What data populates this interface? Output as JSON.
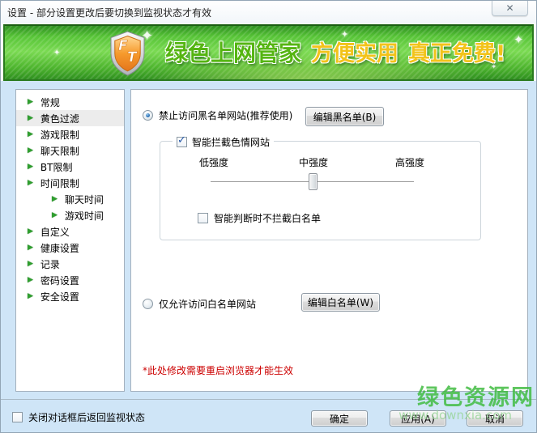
{
  "window": {
    "title": "设置 - 部分设置更改后要切换到监视状态才有效"
  },
  "icons": {
    "close": "✕",
    "tree_arrow": "▶",
    "check": "✓",
    "sparkle": "✦"
  },
  "banner": {
    "logo_letter_f": "F",
    "logo_letter_t": "T",
    "title": "绿色上网管家",
    "tagline1": "方便实用",
    "tagline2": "真正免费!"
  },
  "sidebar": {
    "items": [
      {
        "label": "常规"
      },
      {
        "label": "黄色过滤"
      },
      {
        "label": "游戏限制"
      },
      {
        "label": "聊天限制"
      },
      {
        "label": "BT限制"
      },
      {
        "label": "时间限制"
      },
      {
        "label": "聊天时间"
      },
      {
        "label": "游戏时间"
      },
      {
        "label": "自定义"
      },
      {
        "label": "健康设置"
      },
      {
        "label": "记录"
      },
      {
        "label": "密码设置"
      },
      {
        "label": "安全设置"
      }
    ],
    "active_item": "黄色过滤"
  },
  "main": {
    "blacklist_radio_label": "禁止访问黑名单网站(推荐使用)",
    "blacklist_radio_selected": true,
    "edit_blacklist_button": "编辑黑名单(B)",
    "smart_block_checkbox_label": "智能拦截色情网站",
    "smart_block_checked": true,
    "strength_low": "低强度",
    "strength_mid": "中强度",
    "strength_high": "高强度",
    "strength_value": "中强度",
    "no_block_whitelist_checkbox_label": "智能判断时不拦截白名单",
    "no_block_whitelist_checked": false,
    "whitelist_radio_label": "仅允许访问白名单网站",
    "whitelist_radio_selected": false,
    "edit_whitelist_button": "编辑白名单(W)",
    "restart_note": "*此处修改需要重启浏览器才能生效"
  },
  "footer": {
    "return_monitor_checkbox_label": "关闭对话框后返回监视状态",
    "return_monitor_checked": false,
    "ok_button": "确定",
    "apply_button": "应用(A)",
    "cancel_button": "取消"
  },
  "watermark": {
    "site_name": "绿色资源网",
    "site_url": "www.downxia.com"
  },
  "colors": {
    "banner_green": "#4db52e",
    "accent_green": "#2f9e2f",
    "note_red": "#cc0000",
    "content_bg": "#cfe5f7",
    "watermark_green": "#3aba3a"
  }
}
